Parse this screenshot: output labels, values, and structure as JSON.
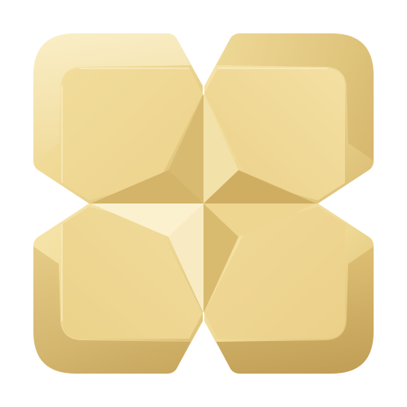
{
  "emblem": {
    "icon": "gold-four-petal-faceted-emblem-icon",
    "colors": {
      "base": "#eed893",
      "highlight": "#fbf1cf",
      "light": "#f5e3ab",
      "mid": "#e3c77e",
      "shadow": "#c9a65c",
      "deep_shadow": "#b8934a",
      "background": "#ffffff"
    }
  }
}
